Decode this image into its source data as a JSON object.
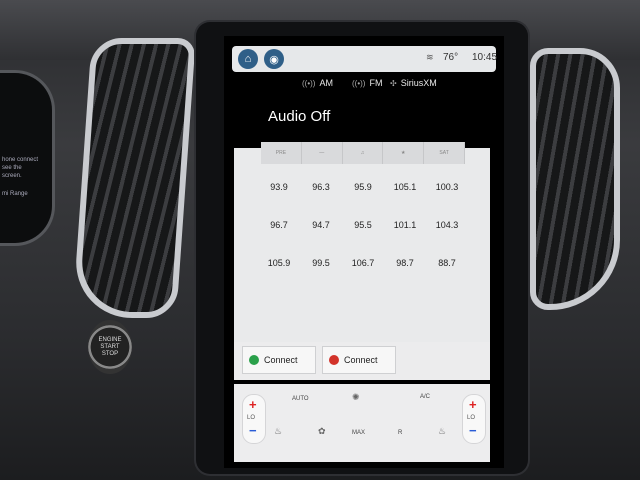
{
  "status": {
    "signal": "≋",
    "temperature": "76°",
    "clock": "10:45"
  },
  "sources": [
    {
      "icon": "((•))",
      "label": "AM"
    },
    {
      "icon": "((•))",
      "label": "FM"
    },
    {
      "icon": "✣",
      "label": "SiriusXM"
    }
  ],
  "audio": {
    "title": "Audio Off"
  },
  "preset_tabs": [
    "PRE",
    "—",
    "♫",
    "★",
    "SAT"
  ],
  "presets": [
    "93.9",
    "96.3",
    "95.9",
    "105.1",
    "100.3",
    "96.7",
    "94.7",
    "95.5",
    "101.1",
    "104.3",
    "105.9",
    "99.5",
    "106.7",
    "98.7",
    "88.7"
  ],
  "connect": [
    {
      "label": "Connect",
      "color": "#2aa04a"
    },
    {
      "label": "Connect",
      "color": "#d2332a"
    }
  ],
  "climate": {
    "left_temp": "LO",
    "right_temp": "LO",
    "auto_label": "AUTO",
    "ac_label": "A/C",
    "max_label": "MAX",
    "recirc_label": "R"
  },
  "cluster": {
    "line1": "hone connect",
    "line2": "see the",
    "line3": "screen.",
    "line4": "mi Range"
  },
  "engine": {
    "label1": "ENGINE",
    "label2": "START",
    "label3": "STOP"
  }
}
